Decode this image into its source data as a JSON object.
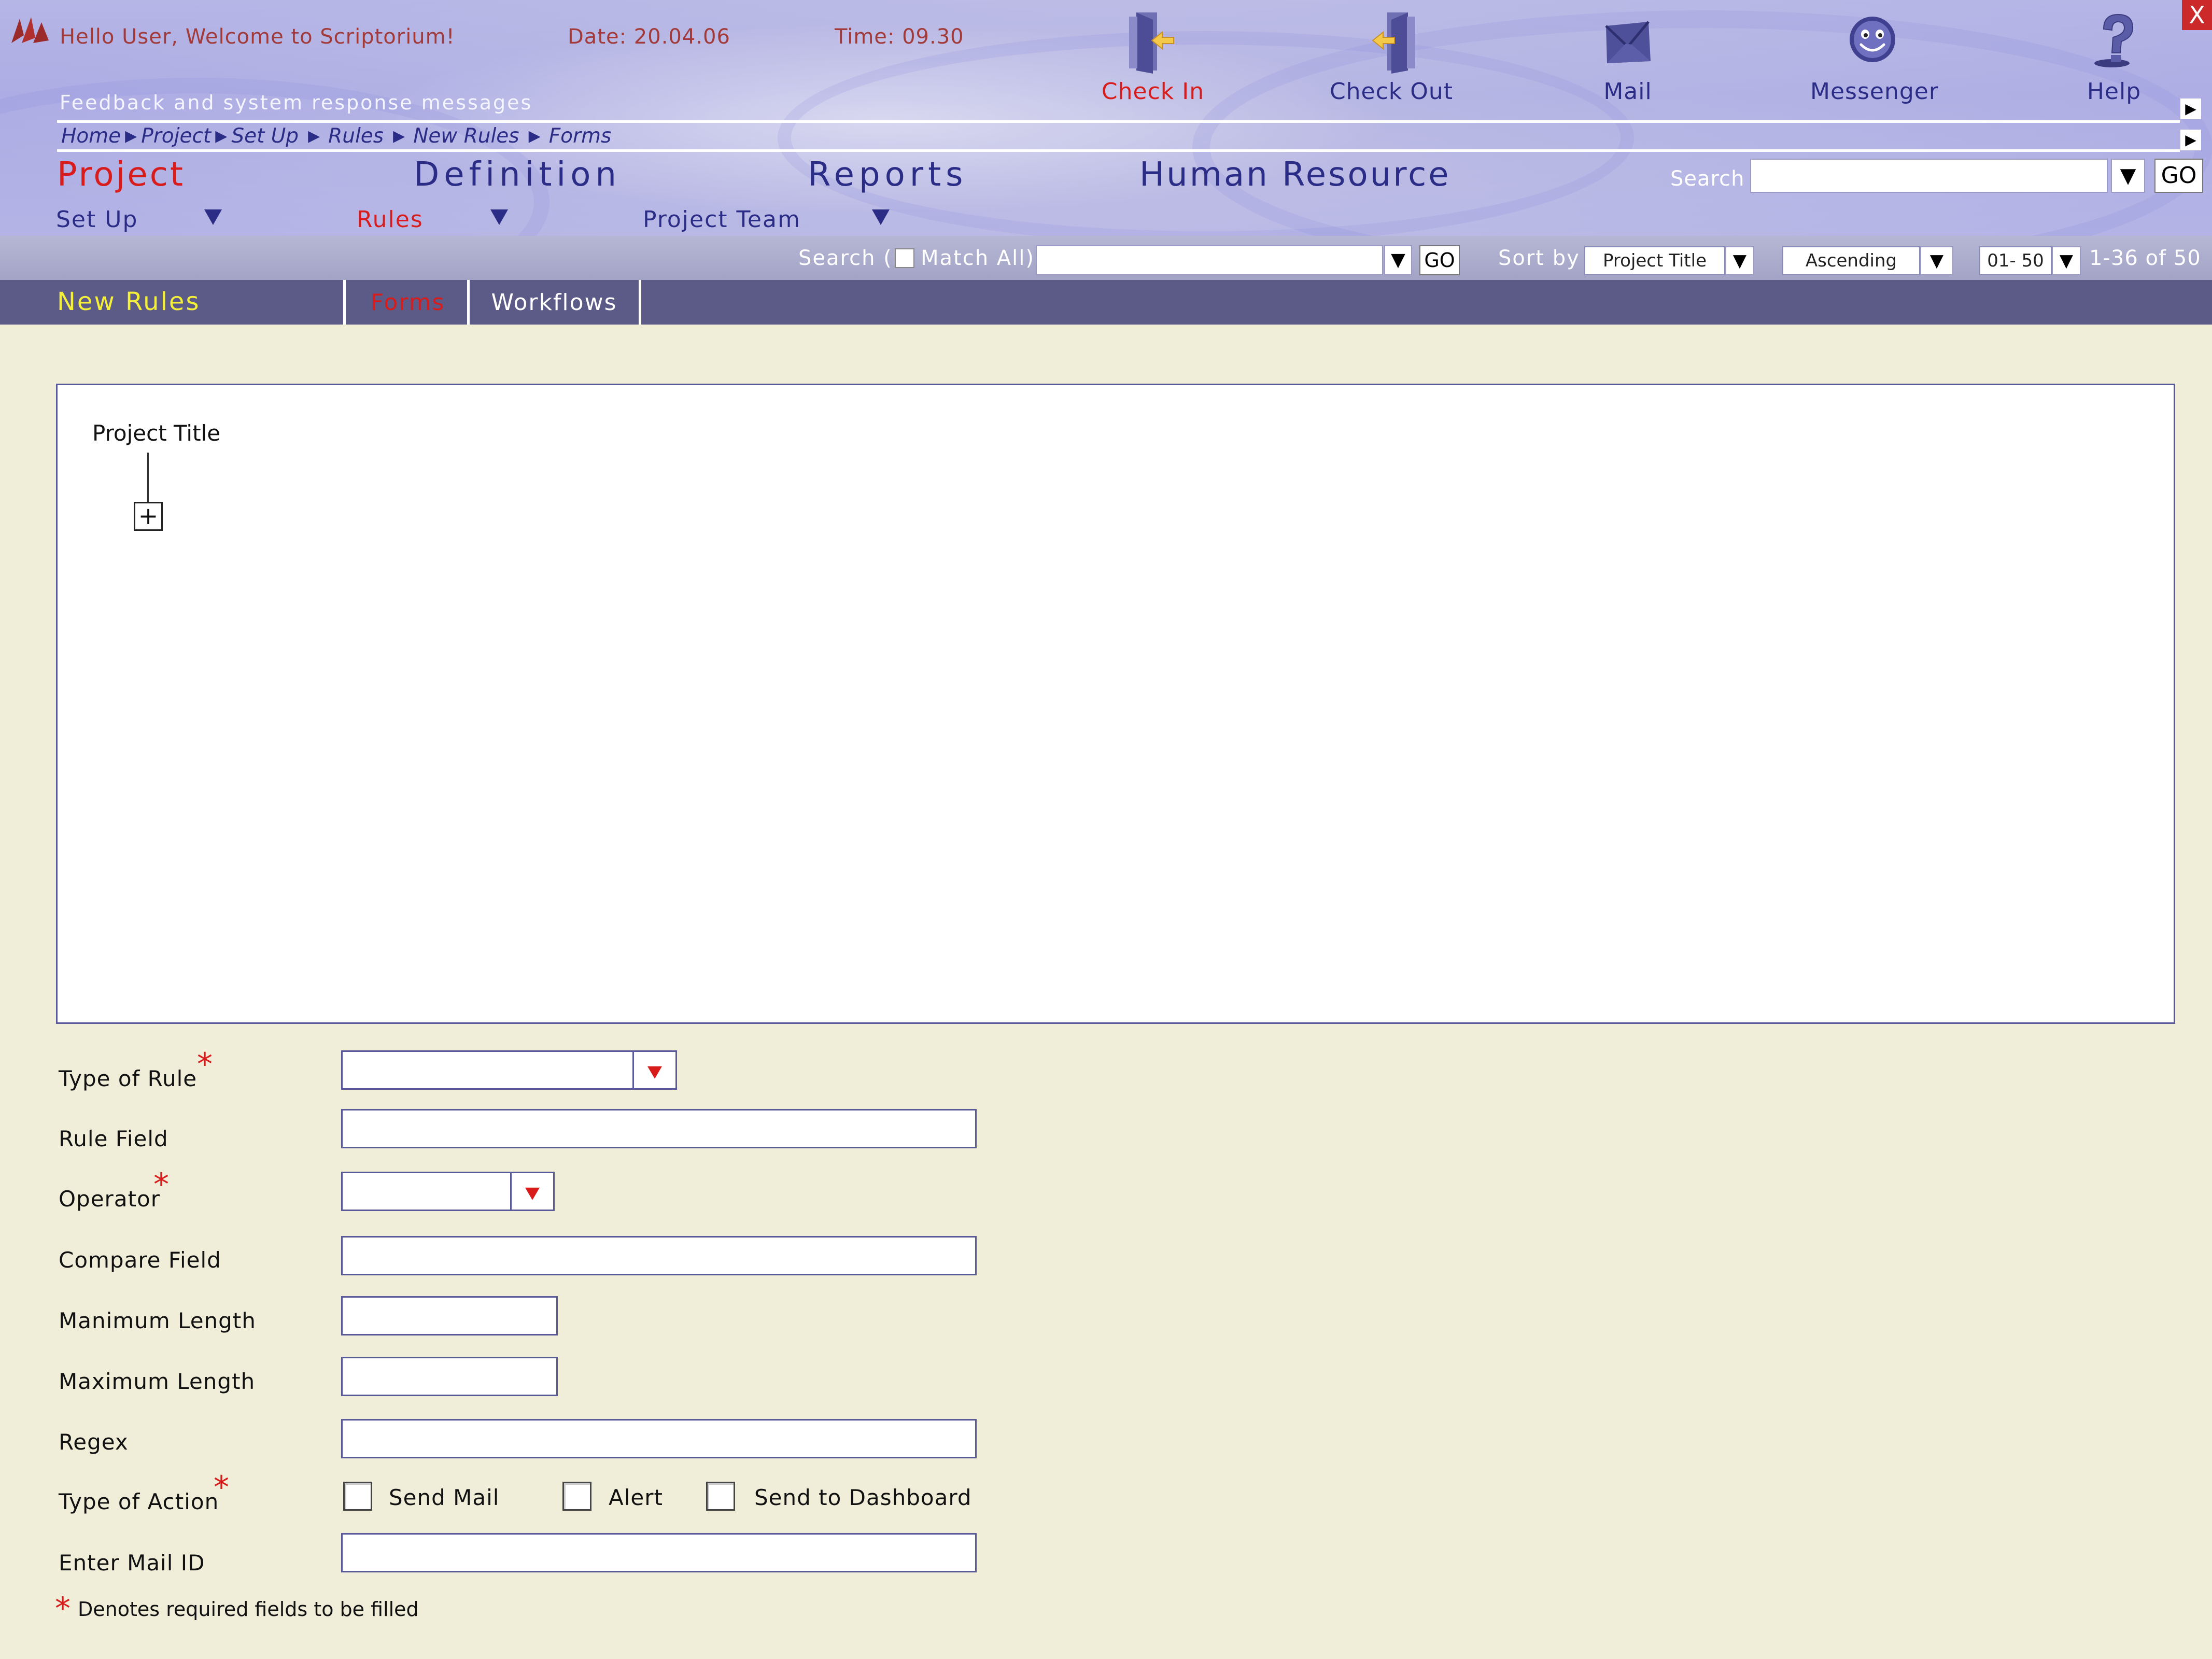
{
  "header": {
    "greeting": "Hello User, Welcome to Scriptorium!",
    "date": "Date: 20.04.06",
    "time": "Time: 09.30",
    "close_label": "X",
    "feedback": "Feedback and system response messages",
    "tools": [
      {
        "label": "Check In",
        "icon": "check-in-icon"
      },
      {
        "label": "Check Out",
        "icon": "check-out-icon"
      },
      {
        "label": "Mail",
        "icon": "mail-icon"
      },
      {
        "label": "Messenger",
        "icon": "messenger-icon"
      },
      {
        "label": "Help",
        "icon": "help-icon"
      }
    ],
    "breadcrumb": [
      "Home",
      "Project",
      "Set Up",
      "Rules",
      "New Rules",
      "Forms"
    ],
    "main_nav": [
      "Project",
      "Definition",
      "Reports",
      "Human Resource"
    ],
    "sub_nav": [
      "Set Up",
      "Rules",
      "Project Team"
    ],
    "search": {
      "label": "Search",
      "value": "",
      "go": "GO"
    }
  },
  "filter_bar": {
    "search_prefix": "Search (",
    "match_all": "Match All)",
    "go": "GO",
    "sort_by": "Sort by",
    "sort_field": "Project Title",
    "sort_order": "Ascending",
    "range": "01- 50",
    "count": "1-36 of 50"
  },
  "tabs": {
    "section": "New Rules",
    "items": [
      "Forms",
      "Workflows"
    ]
  },
  "tree": {
    "root": "Project Title",
    "expander": "+"
  },
  "form": {
    "type_of_rule": "Type of Rule",
    "rule_field": "Rule Field",
    "operator": "Operator",
    "compare_field": "Compare Field",
    "min_length": "Manimum Length",
    "max_length": "Maximum Length",
    "regex": "Regex",
    "type_of_action": "Type of Action",
    "enter_mail_id": "Enter Mail ID",
    "actions": [
      "Send Mail",
      "Alert",
      "Send to Dashboard"
    ],
    "required_marker": "*",
    "required_note": "Denotes required fields to be filled"
  },
  "colors": {
    "accent_red": "#d81b1b",
    "nav_blue": "#2b2c86",
    "tab_bar": "#5c5a86",
    "page_bg": "#f0edd8"
  }
}
